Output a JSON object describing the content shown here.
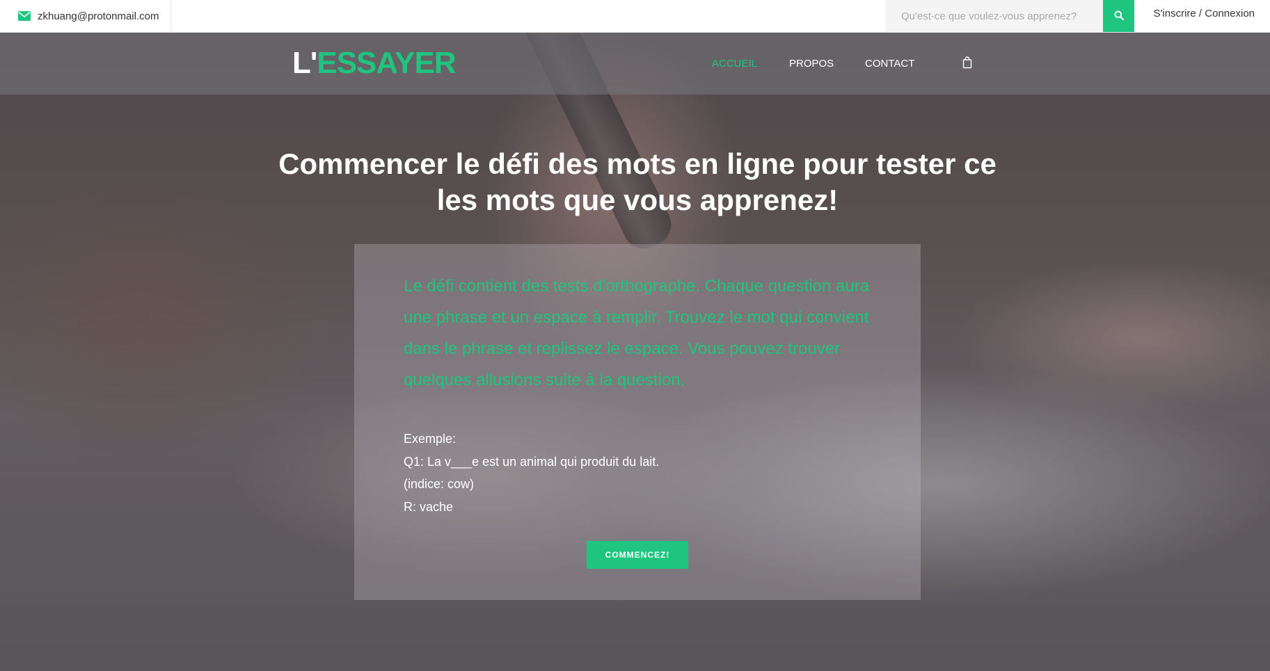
{
  "topbar": {
    "email": "zkhuang@protonmail.com",
    "search_placeholder": "Qu'est-ce que voulez-vous apprenez?",
    "auth_signup": "S'inscrire",
    "auth_separator": " / ",
    "auth_login": "Connexion"
  },
  "brand": {
    "logo_prefix": "L'",
    "logo_main": "ESSAYER",
    "accent_color": "#1fc57f"
  },
  "nav": {
    "items": [
      {
        "label": "ACCUEIL",
        "active": true
      },
      {
        "label": "PROPOS",
        "active": false
      },
      {
        "label": "CONTACT",
        "active": false
      }
    ],
    "cart_icon": "shopping-bag-icon"
  },
  "hero": {
    "headline_line1": "Commencer le défi des mots en ligne pour tester ce",
    "headline_line2": "les mots que vous apprenez!",
    "intro": "Le défi contient des tests d'orthographe. Chaque question aura une phrase et un espace à remplir. Trouvez le mot qui convient dans le phrase et replissez le espace. Vous pouvez trouver quelques allusions suite à la question.",
    "example": {
      "title": "Exemple:",
      "question": "Q1: La v___e est un animal qui produit du lait.",
      "hint": "(indice: cow)",
      "answer": "R: vache"
    },
    "button_label": "COMMENCEZ!"
  },
  "icons": {
    "email": "envelope-icon",
    "search": "search-icon"
  }
}
